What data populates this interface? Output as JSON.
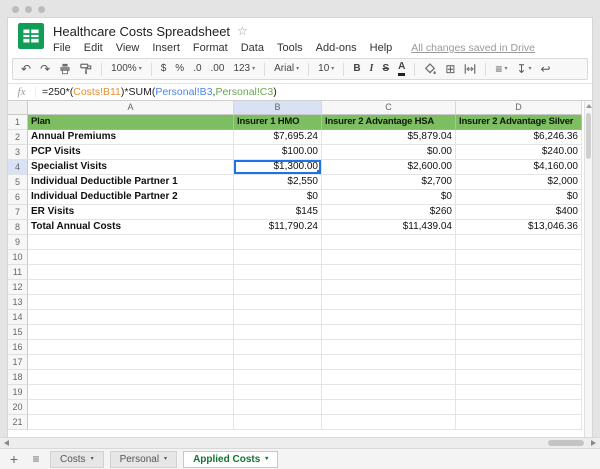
{
  "document": {
    "title": "Healthcare Costs Spreadsheet",
    "star_icon": "☆"
  },
  "menu": {
    "items": [
      "File",
      "Edit",
      "View",
      "Insert",
      "Format",
      "Data",
      "Tools",
      "Add-ons",
      "Help"
    ],
    "saved_status": "All changes saved in Drive"
  },
  "toolbar": {
    "caret_icon": "▾",
    "items": [
      {
        "name": "undo",
        "icon": "↶"
      },
      {
        "name": "redo",
        "icon": "↷"
      },
      {
        "name": "print",
        "svg": "print"
      },
      {
        "name": "paint-format",
        "svg": "paint"
      },
      {
        "name": "sep"
      },
      {
        "name": "zoom-select",
        "label": "100%",
        "caret": true
      },
      {
        "name": "sep"
      },
      {
        "name": "format-as-currency",
        "label": "$"
      },
      {
        "name": "format-as-percent",
        "label": "%"
      },
      {
        "name": "decrease-decimal-places",
        "label": ".0"
      },
      {
        "name": "increase-decimal-places",
        "label": ".00"
      },
      {
        "name": "more-formats",
        "label": "123",
        "caret": true
      },
      {
        "name": "sep"
      },
      {
        "name": "font-family-select",
        "label": "Arial",
        "caret": true
      },
      {
        "name": "sep"
      },
      {
        "name": "font-size-select",
        "label": "10",
        "caret": true
      },
      {
        "name": "sep"
      },
      {
        "name": "bold",
        "label": "B",
        "cls": "b"
      },
      {
        "name": "italic",
        "label": "I",
        "cls": "i"
      },
      {
        "name": "strikethrough",
        "label": "S",
        "cls": "s"
      },
      {
        "name": "text-color",
        "label": "A",
        "cls": "a"
      },
      {
        "name": "sep"
      },
      {
        "name": "fill-color",
        "svg": "fill"
      },
      {
        "name": "borders",
        "icon": "⊞"
      },
      {
        "name": "merge-cells",
        "svg": "merge"
      },
      {
        "name": "sep"
      },
      {
        "name": "horizontal-align",
        "icon": "≡",
        "caret": true
      },
      {
        "name": "vertical-align",
        "icon": "↧",
        "caret": true
      },
      {
        "name": "text-wrap",
        "icon": "↩"
      }
    ]
  },
  "formula_bar": {
    "fx": "fx",
    "segments": [
      {
        "text": "=250*(",
        "color": "#222222"
      },
      {
        "text": "Costs!B11",
        "color": "#e69138"
      },
      {
        "text": ")*SUM(",
        "color": "#222222"
      },
      {
        "text": "Personal!B3",
        "color": "#4a86e8"
      },
      {
        "text": ",",
        "color": "#222222"
      },
      {
        "text": "Personal!C3",
        "color": "#6aa84f"
      },
      {
        "text": ")",
        "color": "#222222"
      }
    ]
  },
  "grid": {
    "column_headers": [
      "A",
      "B",
      "C",
      "D"
    ],
    "row_count": 21,
    "selected": {
      "row": 4,
      "col": "B",
      "value": "$1,300.00"
    },
    "rows": [
      {
        "cells": [
          "Plan",
          "Insurer 1 HMO",
          "Insurer 2 Advantage HSA",
          "Insurer 2 Advantage Silver"
        ]
      },
      {
        "cells": [
          "Annual Premiums",
          "$7,695.24",
          "$5,879.04",
          "$6,246.36"
        ]
      },
      {
        "cells": [
          "PCP Visits",
          "$100.00",
          "$0.00",
          "$240.00"
        ]
      },
      {
        "cells": [
          "Specialist Visits",
          "$1,300.00",
          "$2,600.00",
          "$4,160.00"
        ]
      },
      {
        "cells": [
          "Individual Deductible Partner 1",
          "$2,550",
          "$2,700",
          "$2,000"
        ]
      },
      {
        "cells": [
          "Individual Deductible Partner 2",
          "$0",
          "$0",
          "$0"
        ]
      },
      {
        "cells": [
          "ER Visits",
          "$145",
          "$260",
          "$400"
        ]
      },
      {
        "cells": [
          "Total Annual Costs",
          "$11,790.24",
          "$11,439.04",
          "$13,046.36"
        ]
      }
    ]
  },
  "sheet_tabs": {
    "add_icon": "+",
    "menu_icon": "≡",
    "caret_icon": "▾",
    "tabs": [
      {
        "label": "Costs",
        "active": false
      },
      {
        "label": "Personal",
        "active": false
      },
      {
        "label": "Applied Costs",
        "active": true
      }
    ]
  },
  "colors": {
    "header_row_bg": "#7dbe63",
    "selection_blue": "#1a73e8",
    "active_tab_green": "#137333",
    "logo_green": "#0f9d58"
  }
}
